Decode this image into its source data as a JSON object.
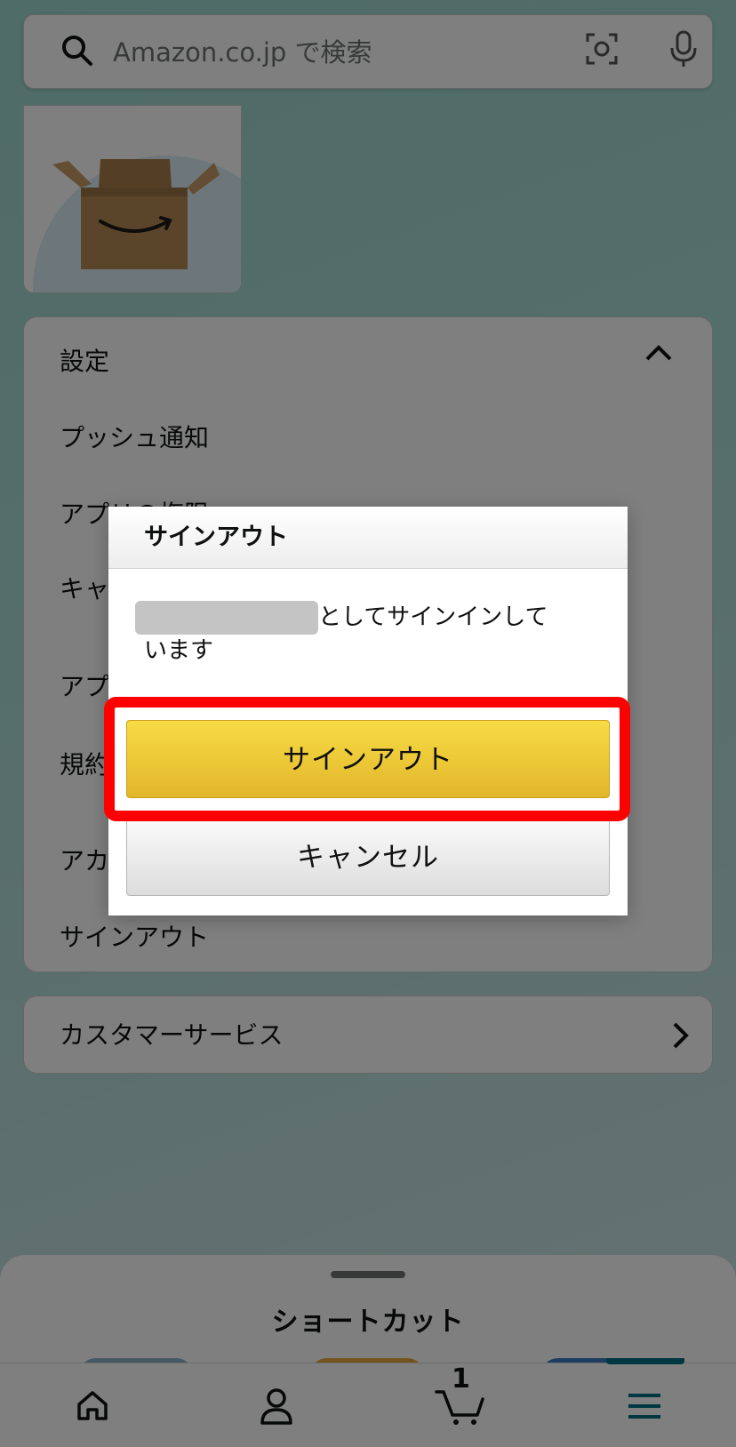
{
  "search": {
    "placeholder": "Amazon.co.jp で検索"
  },
  "settings": {
    "title": "設定",
    "items": [
      "プッシュ通知",
      "アプリの権限",
      "キャ",
      "アプ",
      "規約",
      "アカ",
      "サインアウト"
    ]
  },
  "customer_service": {
    "label": "カスタマーサービス"
  },
  "shortcut_sheet": {
    "title": "ショートカット"
  },
  "bottom_nav": {
    "items": [
      "home-icon",
      "account-icon",
      "cart-icon",
      "menu-icon"
    ],
    "cart_count": "1",
    "active_color": "#007185"
  },
  "dialog": {
    "title": "サインアウト",
    "message_line1": "としてサインインして",
    "message_line2": "います",
    "signout_label": "サインアウト",
    "cancel_label": "キャンセル"
  },
  "colors": {
    "primary_button": "#f0c93a",
    "highlight": "#ff0000"
  }
}
